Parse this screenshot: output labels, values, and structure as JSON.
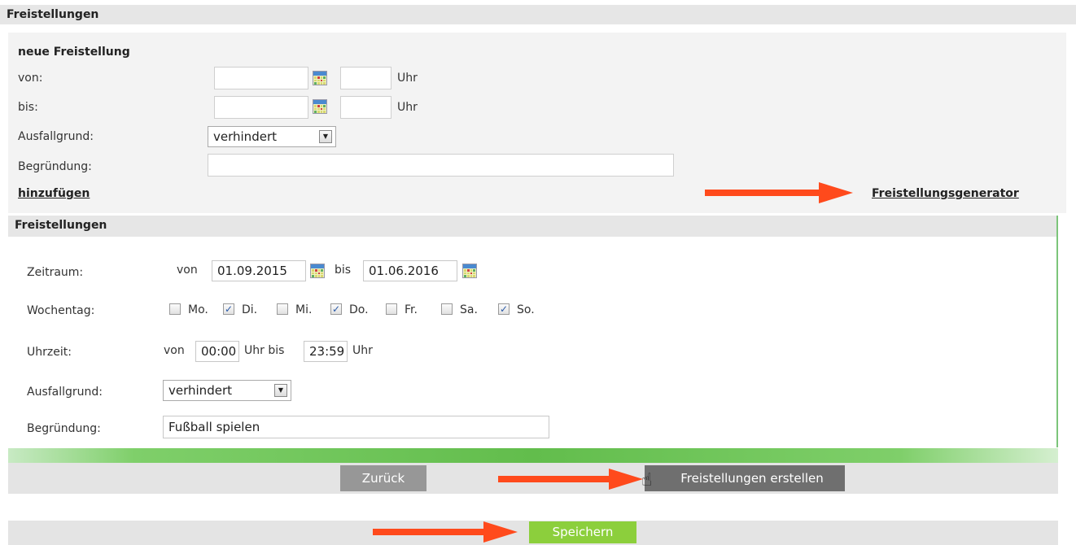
{
  "header": {
    "title": "Freistellungen"
  },
  "new_entry": {
    "heading": "neue Freistellung",
    "from_label": "von:",
    "to_label": "bis:",
    "time_unit": "Uhr",
    "reason_label": "Ausfallgrund:",
    "reason_value": "verhindert",
    "justification_label": "Begründung:",
    "justification_value": "",
    "add_link": "hinzufügen",
    "generator_link": "Freistellungsgenerator"
  },
  "generator": {
    "title": "Freistellungen",
    "period_label": "Zeitraum:",
    "period_from_word": "von",
    "period_from": "01.09.2015",
    "period_to_word": "bis",
    "period_to": "01.06.2016",
    "weekday_label": "Wochentag:",
    "weekdays": [
      {
        "label": "Mo.",
        "checked": false
      },
      {
        "label": "Di.",
        "checked": true
      },
      {
        "label": "Mi.",
        "checked": false
      },
      {
        "label": "Do.",
        "checked": true
      },
      {
        "label": "Fr.",
        "checked": false
      },
      {
        "label": "Sa.",
        "checked": false
      },
      {
        "label": "So.",
        "checked": true
      }
    ],
    "time_label": "Uhrzeit:",
    "time_from_word": "von",
    "time_from": "00:00",
    "time_mid": "Uhr bis",
    "time_to": "23:59",
    "time_unit": "Uhr",
    "reason_label": "Ausfallgrund:",
    "reason_value": "verhindert",
    "justification_label": "Begründung:",
    "justification_value": "Fußball spielen",
    "back_button": "Zurück",
    "create_button": "Freistellungen erstellen"
  },
  "footer": {
    "save_button": "Speichern"
  },
  "colors": {
    "arrow": "#ff4a1c",
    "save_green": "#8ccf3c",
    "accent_green": "#62bd4c"
  }
}
